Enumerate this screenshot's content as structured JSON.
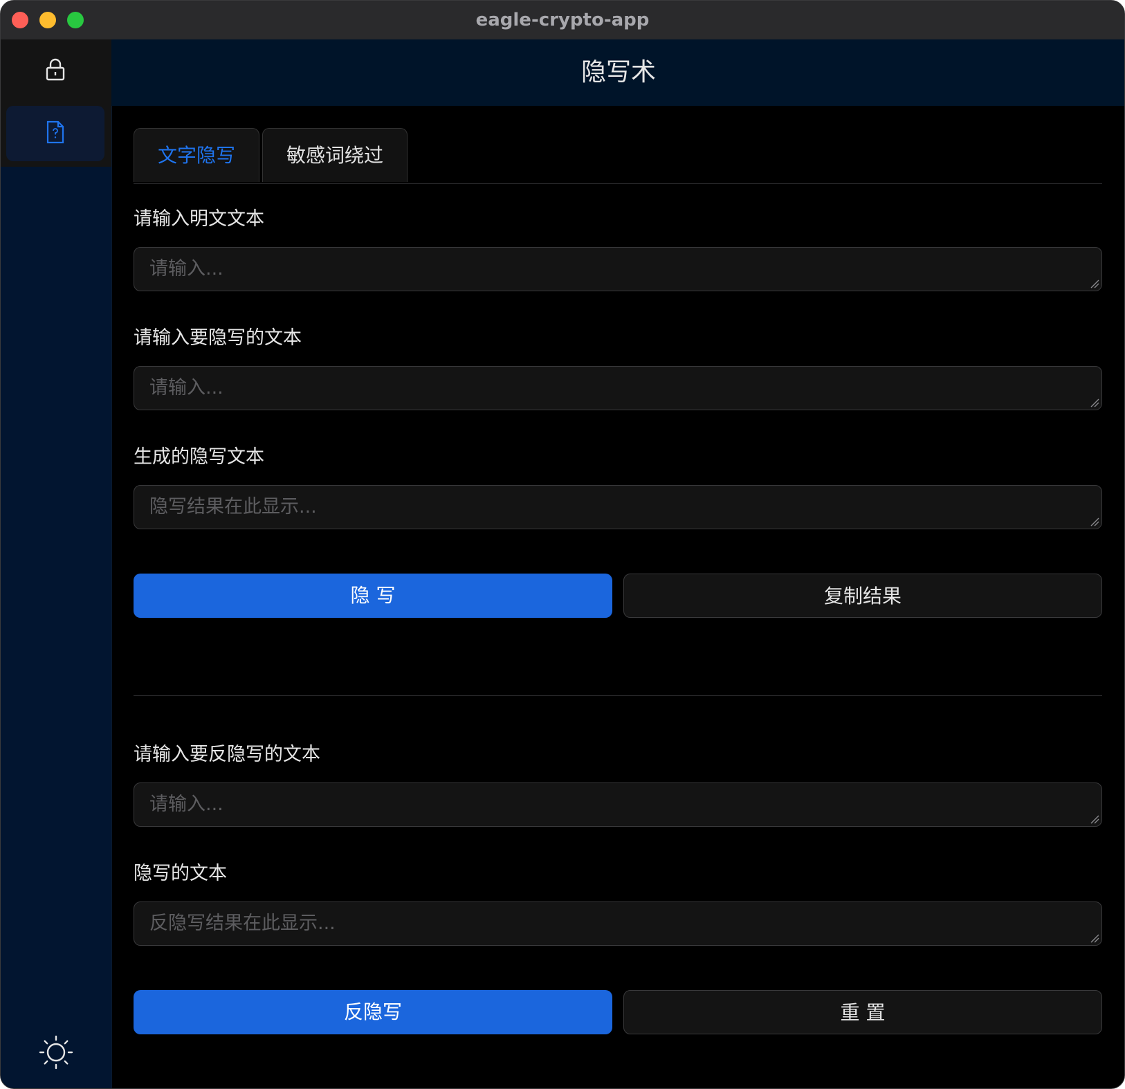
{
  "window": {
    "title": "eagle-crypto-app"
  },
  "sidebar": {
    "items": [
      {
        "icon": "lock-icon",
        "active": false
      },
      {
        "icon": "document-question-icon",
        "active": true
      }
    ],
    "footer_icon": "sun-icon"
  },
  "header": {
    "title": "隐写术"
  },
  "tabs": [
    {
      "label": "文字隐写",
      "active": true
    },
    {
      "label": "敏感词绕过",
      "active": false
    }
  ],
  "encode_section": {
    "plaintext_label": "请输入明文文本",
    "plaintext_placeholder": "请输入...",
    "hidden_label": "请输入要隐写的文本",
    "hidden_placeholder": "请输入...",
    "result_label": "生成的隐写文本",
    "result_placeholder": "隐写结果在此显示...",
    "encode_button": "隐 写",
    "copy_button": "复制结果"
  },
  "decode_section": {
    "input_label": "请输入要反隐写的文本",
    "input_placeholder": "请输入...",
    "output_label": "隐写的文本",
    "output_placeholder": "反隐写结果在此显示...",
    "decode_button": "反隐写",
    "reset_button": "重 置"
  },
  "colors": {
    "accent": "#1b66dd",
    "active_tab_text": "#1f74ee",
    "sidebar_bg": "#021530",
    "header_bg": "#001429"
  }
}
